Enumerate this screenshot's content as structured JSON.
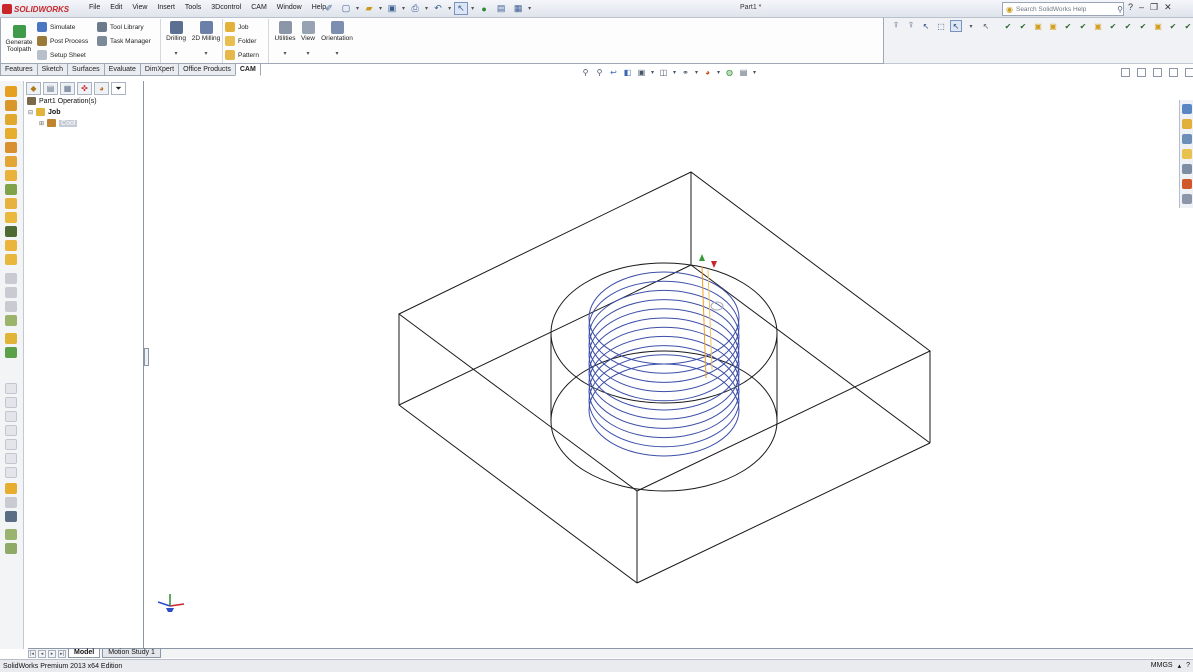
{
  "app": {
    "logo_text": "SOLIDWORKS",
    "document_title": "Part1 *",
    "menu": [
      "File",
      "Edit",
      "View",
      "Insert",
      "Tools",
      "3Dcontrol",
      "CAM",
      "Window",
      "Help"
    ],
    "search_placeholder": "Search SolidWorks Help"
  },
  "command_manager": {
    "generate_toolpath": [
      "Generate",
      "Toolpath"
    ],
    "small_col1": [
      "Simulate",
      "Post Process",
      "Setup Sheet"
    ],
    "small_col2": [
      "Tool Library",
      "Task Manager"
    ],
    "big_buttons": [
      "Drilling",
      "2D Milling"
    ],
    "small_col3": [
      "Job",
      "Folder",
      "Pattern"
    ],
    "big_buttons2": [
      "Utilities",
      "View",
      "Orientation"
    ]
  },
  "tabs": [
    "Features",
    "Sketch",
    "Surfaces",
    "Evaluate",
    "DimXpert",
    "Office Products",
    "CAM"
  ],
  "active_tab": "CAM",
  "feature_manager": {
    "root": "Part1 Operation(s)",
    "job": "Job",
    "child": "Cool"
  },
  "bottom_tabs": [
    "Model",
    "Motion Study 1"
  ],
  "status": {
    "left": "SolidWorks Premium 2013 x64 Edition",
    "units": "MMGS"
  },
  "colors": {
    "accent": "#c9262b",
    "helix": "#3d4fa8",
    "toolpath_lead": "#f0a020",
    "model_edges": "#1a1a1a"
  }
}
